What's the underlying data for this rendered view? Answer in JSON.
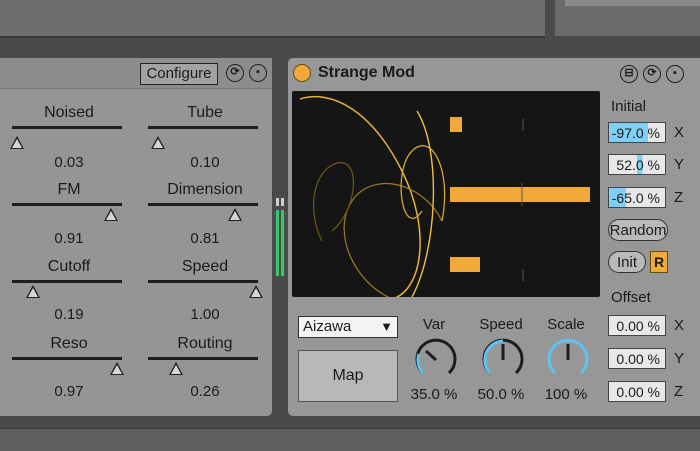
{
  "left_device": {
    "configure_label": "Configure",
    "params": [
      {
        "label": "Noised",
        "value": "0.03",
        "level": 0.03
      },
      {
        "label": "Tube",
        "value": "0.10",
        "level": 0.1
      },
      {
        "label": "FM",
        "value": "0.91",
        "level": 0.91
      },
      {
        "label": "Dimension",
        "value": "0.81",
        "level": 0.81
      },
      {
        "label": "Cutoff",
        "value": "0.19",
        "level": 0.19
      },
      {
        "label": "Speed",
        "value": "1.00",
        "level": 1.0
      },
      {
        "label": "Reso",
        "value": "0.97",
        "level": 0.97
      },
      {
        "label": "Routing",
        "value": "0.26",
        "level": 0.26
      }
    ]
  },
  "right_device": {
    "title": "Strange Mod",
    "initial_label": "Initial",
    "initial": [
      {
        "axis": "X",
        "value": "-97.0 %",
        "fraction": 0.97
      },
      {
        "axis": "Y",
        "value": "52.0 %",
        "fraction": 0.52
      },
      {
        "axis": "Z",
        "value": "-65.0 %",
        "fraction": 0.65
      }
    ],
    "random_label": "Random",
    "init_label": "Init",
    "r_label": "R",
    "offset_label": "Offset",
    "offset": [
      {
        "axis": "X",
        "value": "0.00 %"
      },
      {
        "axis": "Y",
        "value": "0.00 %"
      },
      {
        "axis": "Z",
        "value": "0.00 %"
      }
    ],
    "mode_value": "Aizawa",
    "map_label": "Map",
    "knobs": [
      {
        "label": "Var",
        "value": "35.0 %",
        "level": 0.35
      },
      {
        "label": "Speed",
        "value": "50.0 %",
        "level": 0.5
      },
      {
        "label": "Scale",
        "value": "100 %",
        "level": 1.0
      }
    ],
    "scope_bars": [
      0.05,
      0.45,
      0.13
    ]
  },
  "colors": {
    "accent": "#f2a93b",
    "meter": "#38c86a",
    "knob_arc": "#5bc4f5",
    "field_highlight": "#7fd0f7"
  }
}
